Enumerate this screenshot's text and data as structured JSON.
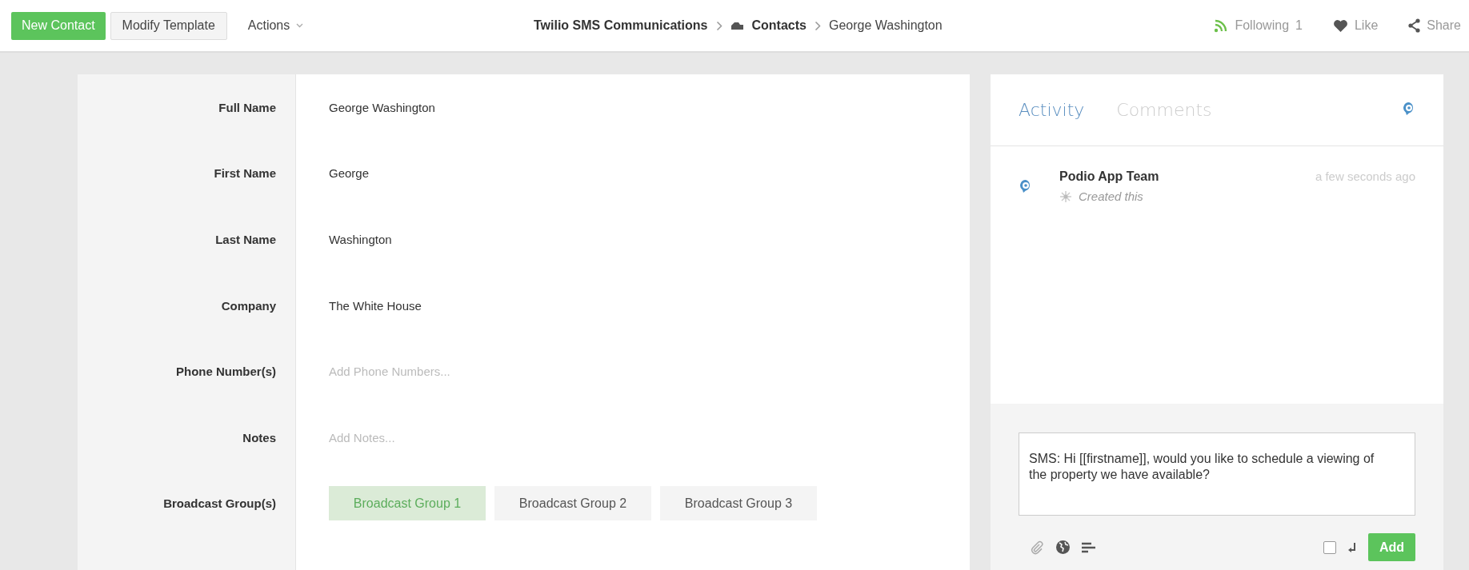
{
  "toolbar": {
    "new_button": "New Contact",
    "modify_button": "Modify Template",
    "actions_menu": "Actions"
  },
  "breadcrumb": [
    {
      "label": "Twilio SMS Communications",
      "kind": "app"
    },
    {
      "label": "Contacts",
      "kind": "space"
    },
    {
      "label": "George Washington",
      "kind": "item"
    }
  ],
  "social": {
    "following_label": "Following",
    "following_count": "1",
    "like": "Like",
    "share": "Share"
  },
  "fields": [
    {
      "label": "Full Name",
      "value": "George Washington"
    },
    {
      "label": "First Name",
      "value": "George"
    },
    {
      "label": "Last Name",
      "value": "Washington"
    },
    {
      "label": "Company",
      "value": "The White House"
    },
    {
      "label": "Phone Number(s)",
      "placeholder": "Add Phone Numbers..."
    },
    {
      "label": "Notes",
      "placeholder": "Add Notes..."
    },
    {
      "label": "Broadcast Group(s)",
      "options": [
        {
          "label": "Broadcast Group 1",
          "selected": true
        },
        {
          "label": "Broadcast Group 2",
          "selected": false
        },
        {
          "label": "Broadcast Group 3",
          "selected": false
        }
      ]
    }
  ],
  "activity_panel": {
    "tabs": [
      {
        "label": "Activity",
        "selected": true
      },
      {
        "label": "Comments",
        "selected": false
      }
    ],
    "entries": [
      {
        "author": "Podio App Team",
        "action": "Created this",
        "time": "a few seconds ago"
      }
    ],
    "comment": {
      "value": "SMS: Hi [[firstname]], would you like to schedule a viewing of the property we have available?",
      "alert_checked": false,
      "submit": "Add"
    }
  }
}
